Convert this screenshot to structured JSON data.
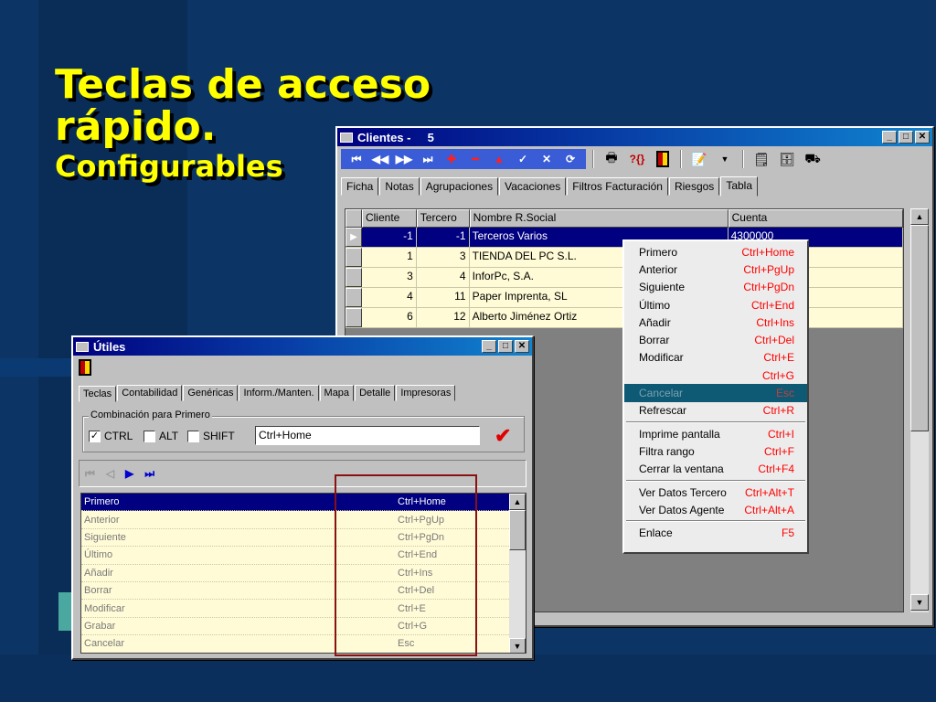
{
  "slide": {
    "title_line1": "Teclas de acceso",
    "title_line2": "rápido.",
    "subtitle": "Configurables"
  },
  "clientes": {
    "title": "Clientes -     5",
    "tabs": [
      "Ficha",
      "Notas",
      "Agrupaciones",
      "Vacaciones",
      "Filtros Facturación",
      "Riesgos",
      "Tabla"
    ],
    "active_tab": "Tabla",
    "columns": [
      "Cliente",
      "Tercero",
      "Nombre R.Social",
      "Cuenta"
    ],
    "rows": [
      {
        "cliente": "-1",
        "tercero": "-1",
        "nombre": "Terceros Varios",
        "cuenta": "4300000"
      },
      {
        "cliente": "1",
        "tercero": "3",
        "nombre": "TIENDA DEL PC S.L.",
        "cuenta": ""
      },
      {
        "cliente": "3",
        "tercero": "4",
        "nombre": "InforPc, S.A.",
        "cuenta": ""
      },
      {
        "cliente": "4",
        "tercero": "11",
        "nombre": "Paper Imprenta, SL",
        "cuenta": ""
      },
      {
        "cliente": "6",
        "tercero": "12",
        "nombre": "Alberto Jiménez Ortiz",
        "cuenta": ""
      }
    ]
  },
  "menu": {
    "items": [
      {
        "label": "Primero",
        "shortcut": "Ctrl+Home"
      },
      {
        "label": "Anterior",
        "shortcut": "Ctrl+PgUp"
      },
      {
        "label": "Siguiente",
        "shortcut": "Ctrl+PgDn"
      },
      {
        "label": "Último",
        "shortcut": "Ctrl+End"
      },
      {
        "label": "Añadir",
        "shortcut": "Ctrl+Ins"
      },
      {
        "label": "Borrar",
        "shortcut": "Ctrl+Del"
      },
      {
        "label": "Modificar",
        "shortcut": "Ctrl+E"
      },
      {
        "label": "",
        "shortcut": "Ctrl+G"
      },
      {
        "label": "Cancelar",
        "shortcut": "Esc"
      },
      {
        "label": "Refrescar",
        "shortcut": "Ctrl+R"
      },
      {
        "label": "Imprime pantalla",
        "shortcut": "Ctrl+I"
      },
      {
        "label": "Filtra rango",
        "shortcut": "Ctrl+F"
      },
      {
        "label": "Cerrar la ventana",
        "shortcut": "Ctrl+F4"
      },
      {
        "label": "Ver Datos Tercero",
        "shortcut": "Ctrl+Alt+T"
      },
      {
        "label": "Ver Datos Agente",
        "shortcut": "Ctrl+Alt+A"
      },
      {
        "label": "Enlace",
        "shortcut": "F5"
      }
    ]
  },
  "utiles": {
    "title": "Útiles",
    "tabs": [
      "Teclas",
      "Contabilidad",
      "Genéricas",
      "Inform./Manten.",
      "Mapa",
      "Detalle",
      "Impresoras"
    ],
    "group_label": "Combinación para Primero",
    "ctrl_label": "CTRL",
    "alt_label": "ALT",
    "shift_label": "SHIFT",
    "ctrl_checked": "✓",
    "shortcut_value": "Ctrl+Home",
    "list": [
      {
        "name": "Primero",
        "key": "Ctrl+Home"
      },
      {
        "name": "Anterior",
        "key": "Ctrl+PgUp"
      },
      {
        "name": "Siguiente",
        "key": "Ctrl+PgDn"
      },
      {
        "name": "Último",
        "key": "Ctrl+End"
      },
      {
        "name": "Añadir",
        "key": "Ctrl+Ins"
      },
      {
        "name": "Borrar",
        "key": "Ctrl+Del"
      },
      {
        "name": "Modificar",
        "key": "Ctrl+E"
      },
      {
        "name": "Grabar",
        "key": "Ctrl+G"
      },
      {
        "name": "Cancelar",
        "key": "Esc"
      }
    ]
  },
  "colors": {
    "background": "#0c3566",
    "title_yellow": "#ffff00",
    "titlebar": "#000080",
    "highlight_box": "#8b1010",
    "shortcut_red": "#ff0000"
  }
}
